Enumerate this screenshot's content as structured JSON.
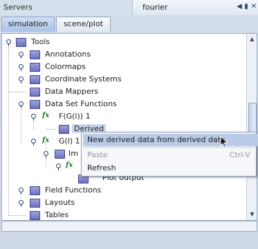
{
  "titlebar": {
    "left_title": "Servers",
    "right_title": "fourier",
    "buttons": [
      "◀",
      "▮",
      "✕"
    ]
  },
  "tabs": [
    {
      "label": "simulation",
      "active": true
    },
    {
      "label": "scene/plot",
      "active": false
    }
  ],
  "tree": {
    "root": "Tools",
    "items": [
      "Annotations",
      "Colormaps",
      "Coordinate Systems",
      "Data Mappers",
      "Data Set Functions"
    ],
    "dsf_children": [
      {
        "label": "F(G(l)) 1",
        "child": "Derived"
      },
      {
        "label": "G(l) 1",
        "child": "Im"
      }
    ],
    "plot_output": "Plot output",
    "tail_items": [
      "Field Functions",
      "Layouts",
      "Tables"
    ]
  },
  "context_menu": {
    "new_derived": "New derived data from derived data",
    "paste": "Paste",
    "paste_shortcut": "Ctrl-V",
    "refresh": "Refresh"
  },
  "colors": {
    "accent": "#b9cbe6",
    "folder": "#7a7ec8",
    "fx": "#1a7a1a"
  }
}
